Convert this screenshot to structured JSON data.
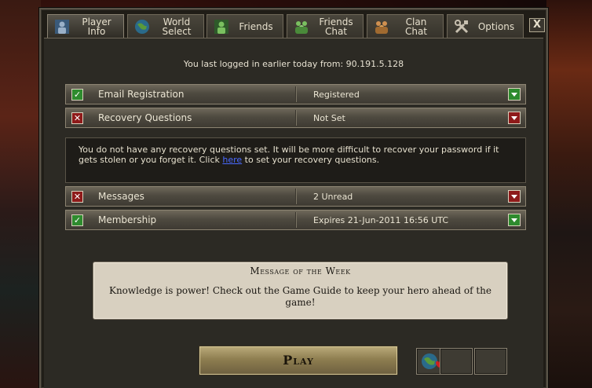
{
  "tabs": [
    {
      "label": "Player\nInfo",
      "icon": "player-icon",
      "active": true
    },
    {
      "label": "World\nSelect",
      "icon": "globe-icon",
      "active": false
    },
    {
      "label": "Friends",
      "icon": "friend-icon",
      "active": false
    },
    {
      "label": "Friends\nChat",
      "icon": "friends-chat-icon",
      "active": false
    },
    {
      "label": "Clan\nChat",
      "icon": "clan-chat-icon",
      "active": false
    },
    {
      "label": "Options",
      "icon": "tools-icon",
      "active": false
    }
  ],
  "close_label": "X",
  "last_login": "You last logged in earlier today from: 90.191.5.128",
  "rows": [
    {
      "label": "Email Registration",
      "value": "Registered",
      "status": "ok"
    },
    {
      "label": "Recovery Questions",
      "value": "Not Set",
      "status": "bad"
    },
    {
      "label": "Messages",
      "value": "2 Unread",
      "status": "bad"
    },
    {
      "label": "Membership",
      "value": "Expires 21-Jun-2011 16:56 UTC",
      "status": "ok"
    }
  ],
  "recovery_message": {
    "before": "You do not have any recovery questions set. It will be more difficult to recover your password if it gets stolen or you forget it. Click ",
    "link": "here",
    "after": " to set your recovery questions."
  },
  "message_of_week": {
    "title": "Message of the Week",
    "text": "Knowledge is power! Check out the Game Guide to keep your hero ahead of the game!"
  },
  "play_label": "Play",
  "status_glyphs": {
    "ok": "✓",
    "bad": "✕"
  },
  "colors": {
    "ok": "#2e8b2e",
    "bad": "#8e1a1a",
    "link": "#4a6aff"
  }
}
